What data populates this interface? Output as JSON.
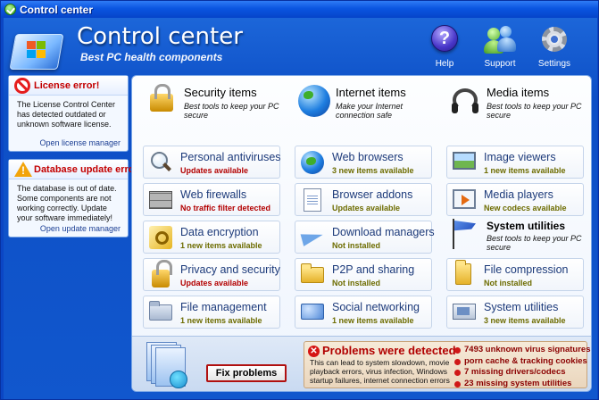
{
  "window": {
    "title": "Control center"
  },
  "header": {
    "title": "Control center",
    "subtitle": "Best PC health components",
    "buttons": [
      {
        "label": "Help",
        "icon": "help-icon"
      },
      {
        "label": "Support",
        "icon": "support-icon"
      },
      {
        "label": "Settings",
        "icon": "gear-icon"
      }
    ]
  },
  "alerts": {
    "license": {
      "title": "License error!",
      "body": "The License Control Center has detected outdated or unknown software license.",
      "link": "Open license manager"
    },
    "database": {
      "title": "Database update error!",
      "body": "The database is out of date. Some components are not working correctly. Update your software immediately!",
      "link": "Open update manager"
    }
  },
  "sections": {
    "security": {
      "title": "Security items",
      "desc": "Best tools to keep your PC secure"
    },
    "internet": {
      "title": "Internet items",
      "desc": "Make your Internet connection safe"
    },
    "media": {
      "title": "Media items",
      "desc": "Best tools to keep your PC secure"
    },
    "system": {
      "title": "System utilities",
      "desc": "Best tools to keep your PC secure"
    }
  },
  "tiles": {
    "security": [
      {
        "title": "Personal antiviruses",
        "status": "Updates available",
        "icon": "magnifier-icon"
      },
      {
        "title": "Web firewalls",
        "status": "No traffic filter detected",
        "icon": "firewall-icon"
      },
      {
        "title": "Data encryption",
        "status": "1 new items available",
        "icon": "key-icon"
      },
      {
        "title": "Privacy and security",
        "status": "Updates available",
        "icon": "lock-icon"
      },
      {
        "title": "File management",
        "status": "1 new items available",
        "icon": "folder-icon"
      }
    ],
    "internet": [
      {
        "title": "Web browsers",
        "status": "3 new items available",
        "icon": "globe-icon"
      },
      {
        "title": "Browser addons",
        "status": "Updates available",
        "icon": "addon-icon"
      },
      {
        "title": "Download managers",
        "status": "Not installed",
        "icon": "paper-plane-icon"
      },
      {
        "title": "P2P and sharing",
        "status": "Not installed",
        "icon": "shared-folder-icon"
      },
      {
        "title": "Social networking",
        "status": "1 new items available",
        "icon": "network-icon"
      }
    ],
    "media": [
      {
        "title": "Image viewers",
        "status": "1 new items available",
        "icon": "image-icon"
      },
      {
        "title": "Media players",
        "status": "New codecs available",
        "icon": "media-player-icon"
      }
    ],
    "system": [
      {
        "title": "File compression",
        "status": "Not installed",
        "icon": "zip-icon"
      },
      {
        "title": "System utilities",
        "status": "3 new items available",
        "icon": "system-utilities-icon"
      }
    ]
  },
  "problems": {
    "button": "Fix problems",
    "title": "Problems were detected",
    "desc": "This can lead to system slowdown, movie playback errors, virus infection, Windows startup failures, internet connection errors",
    "items": [
      "7493 unknown virus signatures",
      "porn cache & tracking cookies",
      "7 missing drivers/codecs",
      "23 missing system utilities"
    ]
  },
  "colors": {
    "window_blue": "#0b46c4",
    "status_red": "#b30000",
    "status_olive": "#6d6c00",
    "tile_title": "#1c3a7a",
    "alert_red": "#c30000"
  }
}
